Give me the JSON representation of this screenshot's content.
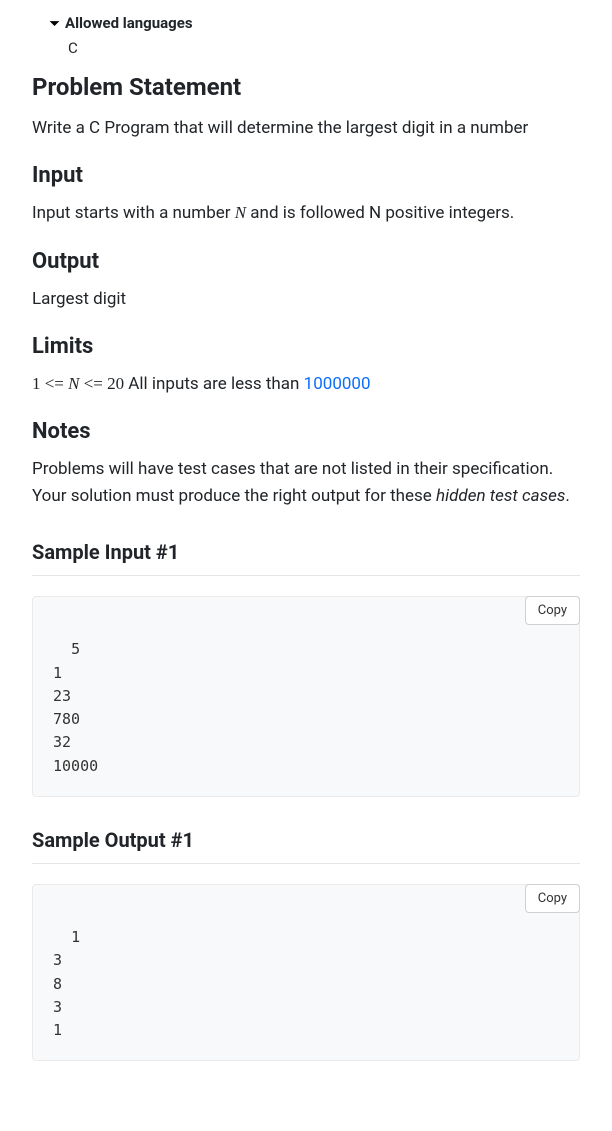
{
  "allowed": {
    "label": "Allowed languages",
    "languages": "C"
  },
  "headings": {
    "problem": "Problem Statement",
    "input": "Input",
    "output": "Output",
    "limits": "Limits",
    "notes": "Notes",
    "sampleInput1": "Sample Input #1",
    "sampleOutput1": "Sample Output #1"
  },
  "text": {
    "problem": "Write a C Program that will determine the largest digit in a number",
    "input_pre": "Input starts with a number ",
    "input_var": "N",
    "input_post": " and is followed N positive integers.",
    "output": "Largest digit",
    "limits_num1": "1",
    "limits_op1": "<=",
    "limits_var": "N",
    "limits_op2": "<=",
    "limits_num2": "20",
    "limits_mid": " All inputs are less than ",
    "limits_link": "1000000",
    "notes_pre": "Problems will have test cases that are not listed in their specification. Your solution must produce the right output for these ",
    "notes_em": "hidden test cases",
    "notes_post": "."
  },
  "samples": {
    "input1": "5\n1\n23\n780\n32\n10000",
    "output1": "1\n3\n8\n3\n1"
  },
  "buttons": {
    "copy": "Copy"
  }
}
